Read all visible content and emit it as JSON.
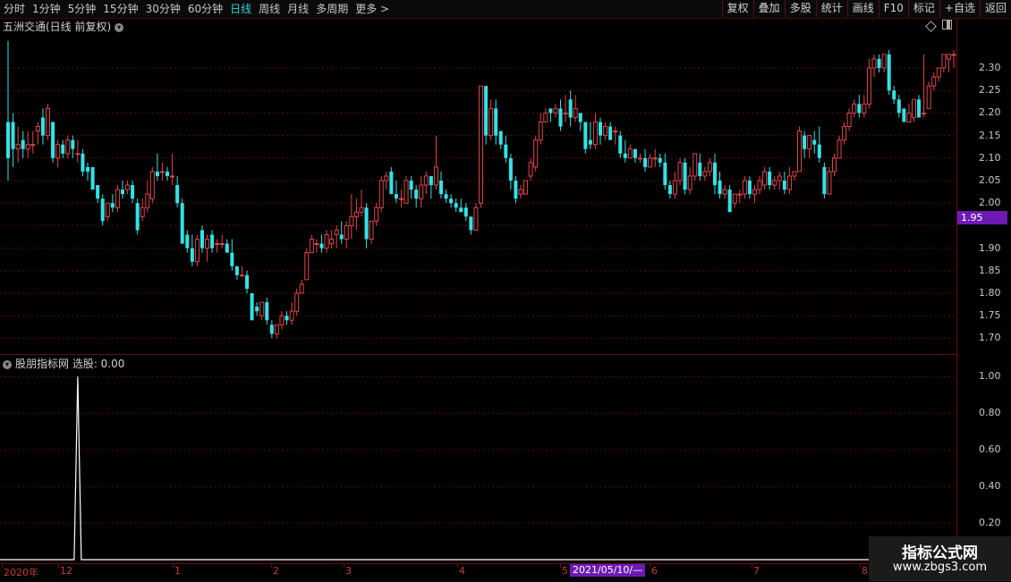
{
  "toolbar": {
    "periods": [
      "分时",
      "1分钟",
      "5分钟",
      "15分钟",
      "30分钟",
      "60分钟",
      "日线",
      "周线",
      "月线",
      "多周期",
      "更多 >"
    ],
    "active_period": "日线",
    "tools": [
      "复权",
      "叠加",
      "多股",
      "统计",
      "画线",
      "F10",
      "标记",
      "+自选",
      "返回"
    ]
  },
  "main_chart": {
    "title": "五洲交通(日线 前复权)",
    "current_price_tag": "1.95",
    "y_ticks": [
      "2.30",
      "2.25",
      "2.20",
      "2.15",
      "2.10",
      "2.05",
      "2.00",
      "1.95",
      "1.90",
      "1.85",
      "1.80",
      "1.75",
      "1.70"
    ]
  },
  "indicator": {
    "title": "股朋指标网 选股: 0.00",
    "y_ticks": [
      "1.00",
      "0.80",
      "0.60",
      "0.40",
      "0.20"
    ]
  },
  "time_axis": {
    "labels": [
      "2020年",
      "12",
      "1",
      "2",
      "3",
      "4",
      "5",
      "6",
      "7",
      "8"
    ],
    "cursor_date": "2021/05/10/—"
  },
  "watermark": {
    "title": "指标公式网",
    "url": "www.zbgs3.com"
  },
  "colors": {
    "up": "#e0464a",
    "down": "#33e2e6",
    "axis": "#6a0d0d",
    "highlight": "#6d1bb3"
  },
  "chart_data": {
    "type": "candlestick",
    "title": "五洲交通(日线 前复权)",
    "ylim": [
      1.68,
      2.35
    ],
    "current_price": 1.95,
    "candles": [
      [
        2.18,
        2.1,
        2.36,
        2.05
      ],
      [
        2.18,
        2.12,
        2.2,
        2.08
      ],
      [
        2.12,
        2.13,
        2.17,
        2.09
      ],
      [
        2.14,
        2.12,
        2.16,
        2.1
      ],
      [
        2.12,
        2.13,
        2.16,
        2.1
      ],
      [
        2.13,
        2.13,
        2.16,
        2.11
      ],
      [
        2.16,
        2.17,
        2.18,
        2.13
      ],
      [
        2.19,
        2.15,
        2.21,
        2.13
      ],
      [
        2.15,
        2.21,
        2.22,
        2.14
      ],
      [
        2.18,
        2.1,
        2.18,
        2.09
      ],
      [
        2.1,
        2.13,
        2.14,
        2.08
      ],
      [
        2.13,
        2.11,
        2.14,
        2.1
      ],
      [
        2.11,
        2.14,
        2.15,
        2.1
      ],
      [
        2.14,
        2.12,
        2.15,
        2.1
      ],
      [
        2.11,
        2.11,
        2.14,
        2.09
      ],
      [
        2.11,
        2.07,
        2.12,
        2.06
      ],
      [
        2.08,
        2.07,
        2.09,
        2.05
      ],
      [
        2.08,
        2.03,
        2.08,
        2.03
      ],
      [
        2.04,
        2.01,
        2.04,
        2.0
      ],
      [
        2.01,
        1.96,
        2.02,
        1.95
      ],
      [
        1.97,
        2.0,
        2.0,
        1.96
      ],
      [
        2.0,
        1.99,
        2.02,
        1.98
      ],
      [
        1.99,
        2.03,
        2.04,
        1.98
      ],
      [
        2.03,
        2.02,
        2.05,
        2.01
      ],
      [
        2.03,
        2.04,
        2.05,
        2.02
      ],
      [
        2.04,
        2.01,
        2.05,
        2.0
      ],
      [
        2.0,
        1.94,
        2.01,
        1.93
      ],
      [
        1.97,
        1.99,
        2.01,
        1.96
      ],
      [
        1.99,
        2.02,
        2.05,
        1.98
      ],
      [
        2.01,
        2.07,
        2.08,
        2.0
      ],
      [
        2.07,
        2.06,
        2.11,
        2.05
      ],
      [
        2.07,
        2.07,
        2.09,
        2.05
      ],
      [
        2.07,
        2.06,
        2.08,
        2.05
      ],
      [
        2.06,
        2.06,
        2.11,
        2.04
      ],
      [
        2.04,
        2.0,
        2.06,
        1.99
      ],
      [
        2.0,
        1.91,
        2.01,
        1.91
      ],
      [
        1.93,
        1.9,
        1.94,
        1.89
      ],
      [
        1.9,
        1.87,
        1.93,
        1.86
      ],
      [
        1.87,
        1.92,
        1.93,
        1.86
      ],
      [
        1.94,
        1.9,
        1.95,
        1.89
      ],
      [
        1.9,
        1.92,
        1.93,
        1.87
      ],
      [
        1.93,
        1.9,
        1.94,
        1.89
      ],
      [
        1.91,
        1.91,
        1.92,
        1.89
      ],
      [
        1.91,
        1.91,
        1.93,
        1.9
      ],
      [
        1.91,
        1.89,
        1.92,
        1.89
      ],
      [
        1.89,
        1.86,
        1.92,
        1.85
      ],
      [
        1.86,
        1.84,
        1.86,
        1.83
      ],
      [
        1.84,
        1.84,
        1.86,
        1.84
      ],
      [
        1.84,
        1.81,
        1.85,
        1.8
      ],
      [
        1.8,
        1.74,
        1.8,
        1.74
      ],
      [
        1.77,
        1.76,
        1.78,
        1.75
      ],
      [
        1.75,
        1.78,
        1.78,
        1.74
      ],
      [
        1.78,
        1.74,
        1.79,
        1.73
      ],
      [
        1.73,
        1.71,
        1.74,
        1.7
      ],
      [
        1.71,
        1.73,
        1.73,
        1.7
      ],
      [
        1.73,
        1.75,
        1.76,
        1.72
      ],
      [
        1.75,
        1.74,
        1.76,
        1.73
      ],
      [
        1.74,
        1.76,
        1.78,
        1.73
      ],
      [
        1.76,
        1.8,
        1.81,
        1.75
      ],
      [
        1.8,
        1.82,
        1.83,
        1.8
      ],
      [
        1.83,
        1.89,
        1.9,
        1.83
      ],
      [
        1.89,
        1.92,
        1.93,
        1.89
      ],
      [
        1.91,
        1.91,
        1.92,
        1.89
      ],
      [
        1.91,
        1.9,
        1.93,
        1.89
      ],
      [
        1.9,
        1.93,
        1.94,
        1.89
      ],
      [
        1.91,
        1.92,
        1.94,
        1.9
      ],
      [
        1.93,
        1.94,
        1.95,
        1.9
      ],
      [
        1.93,
        1.92,
        1.96,
        1.91
      ],
      [
        1.92,
        1.95,
        1.96,
        1.9
      ],
      [
        1.95,
        1.97,
        2.02,
        1.92
      ],
      [
        1.97,
        1.98,
        2.01,
        1.94
      ],
      [
        1.98,
        1.99,
        2.03,
        1.97
      ],
      [
        1.99,
        1.92,
        2.0,
        1.9
      ],
      [
        1.92,
        1.96,
        1.96,
        1.91
      ],
      [
        1.96,
        1.99,
        2.0,
        1.95
      ],
      [
        1.99,
        2.05,
        2.06,
        1.98
      ],
      [
        2.05,
        2.06,
        2.07,
        2.03
      ],
      [
        2.07,
        2.02,
        2.08,
        2.02
      ],
      [
        2.02,
        2.01,
        2.05,
        2.0
      ],
      [
        2.01,
        2.01,
        2.03,
        1.99
      ],
      [
        2.0,
        2.05,
        2.06,
        2.0
      ],
      [
        2.05,
        2.03,
        2.06,
        2.01
      ],
      [
        2.03,
        2.01,
        2.04,
        1.99
      ],
      [
        2.01,
        2.04,
        2.06,
        1.99
      ],
      [
        2.04,
        2.06,
        2.07,
        2.02
      ],
      [
        2.06,
        2.04,
        2.06,
        2.01
      ],
      [
        2.04,
        2.08,
        2.15,
        2.03
      ],
      [
        2.05,
        2.02,
        2.07,
        2.01
      ],
      [
        2.02,
        2.01,
        2.03,
        2.0
      ],
      [
        2.01,
        2.0,
        2.02,
        1.99
      ],
      [
        2.0,
        1.99,
        2.01,
        1.98
      ],
      [
        1.99,
        1.98,
        2.01,
        1.98
      ],
      [
        1.99,
        1.97,
        2.0,
        1.96
      ],
      [
        1.97,
        1.94,
        1.97,
        1.93
      ],
      [
        1.94,
        1.99,
        2.0,
        1.94
      ],
      [
        2.0,
        2.26,
        2.26,
        1.99
      ],
      [
        2.26,
        2.15,
        2.26,
        2.13
      ],
      [
        2.15,
        2.21,
        2.23,
        2.14
      ],
      [
        2.21,
        2.15,
        2.23,
        2.13
      ],
      [
        2.16,
        2.13,
        2.16,
        2.12
      ],
      [
        2.13,
        2.1,
        2.15,
        2.09
      ],
      [
        2.1,
        2.05,
        2.11,
        2.03
      ],
      [
        2.05,
        2.01,
        2.06,
        2.0
      ],
      [
        2.02,
        2.03,
        2.04,
        2.01
      ],
      [
        2.02,
        2.05,
        2.05,
        2.02
      ],
      [
        2.06,
        2.09,
        2.1,
        2.05
      ],
      [
        2.08,
        2.14,
        2.15,
        2.07
      ],
      [
        2.14,
        2.18,
        2.2,
        2.13
      ],
      [
        2.18,
        2.2,
        2.21,
        2.18
      ],
      [
        2.21,
        2.2,
        2.21,
        2.18
      ],
      [
        2.2,
        2.21,
        2.22,
        2.19
      ],
      [
        2.21,
        2.17,
        2.23,
        2.16
      ],
      [
        2.2,
        2.2,
        2.24,
        2.18
      ],
      [
        2.23,
        2.19,
        2.25,
        2.17
      ],
      [
        2.19,
        2.21,
        2.24,
        2.18
      ],
      [
        2.2,
        2.18,
        2.2,
        2.16
      ],
      [
        2.18,
        2.12,
        2.18,
        2.11
      ],
      [
        2.14,
        2.13,
        2.18,
        2.12
      ],
      [
        2.13,
        2.18,
        2.2,
        2.12
      ],
      [
        2.18,
        2.15,
        2.19,
        2.13
      ],
      [
        2.15,
        2.17,
        2.18,
        2.14
      ],
      [
        2.17,
        2.14,
        2.18,
        2.14
      ],
      [
        2.16,
        2.16,
        2.17,
        2.13
      ],
      [
        2.15,
        2.11,
        2.16,
        2.1
      ],
      [
        2.11,
        2.1,
        2.14,
        2.09
      ],
      [
        2.1,
        2.12,
        2.13,
        2.1
      ],
      [
        2.12,
        2.1,
        2.12,
        2.09
      ],
      [
        2.1,
        2.1,
        2.11,
        2.09
      ],
      [
        2.1,
        2.08,
        2.12,
        2.07
      ],
      [
        2.08,
        2.1,
        2.11,
        2.08
      ],
      [
        2.1,
        2.1,
        2.12,
        2.08
      ],
      [
        2.1,
        2.09,
        2.11,
        2.08
      ],
      [
        2.09,
        2.04,
        2.11,
        2.03
      ],
      [
        2.04,
        2.02,
        2.05,
        2.01
      ],
      [
        2.02,
        2.05,
        2.07,
        2.01
      ],
      [
        2.05,
        2.09,
        2.1,
        2.04
      ],
      [
        2.09,
        2.03,
        2.1,
        2.02
      ],
      [
        2.03,
        2.06,
        2.08,
        2.02
      ],
      [
        2.06,
        2.11,
        2.11,
        2.05
      ],
      [
        2.09,
        2.06,
        2.11,
        2.05
      ],
      [
        2.06,
        2.07,
        2.08,
        2.05
      ],
      [
        2.07,
        2.09,
        2.1,
        2.06
      ],
      [
        2.09,
        2.04,
        2.11,
        2.02
      ],
      [
        2.05,
        2.02,
        2.07,
        2.01
      ],
      [
        2.02,
        2.03,
        2.04,
        2.01
      ],
      [
        2.03,
        1.98,
        2.04,
        1.98
      ],
      [
        2.0,
        2.02,
        2.02,
        1.99
      ],
      [
        2.02,
        2.02,
        2.03,
        2.0
      ],
      [
        2.02,
        2.05,
        2.06,
        2.01
      ],
      [
        2.05,
        2.02,
        2.06,
        2.01
      ],
      [
        2.02,
        2.03,
        2.04,
        2.0
      ],
      [
        2.03,
        2.05,
        2.06,
        2.02
      ],
      [
        2.04,
        2.07,
        2.08,
        2.03
      ],
      [
        2.07,
        2.04,
        2.08,
        2.03
      ],
      [
        2.04,
        2.05,
        2.06,
        2.03
      ],
      [
        2.05,
        2.06,
        2.07,
        2.03
      ],
      [
        2.05,
        2.03,
        2.07,
        2.02
      ],
      [
        2.03,
        2.06,
        2.08,
        2.02
      ],
      [
        2.06,
        2.07,
        2.07,
        2.05
      ],
      [
        2.07,
        2.16,
        2.17,
        2.07
      ],
      [
        2.15,
        2.12,
        2.16,
        2.1
      ],
      [
        2.12,
        2.15,
        2.15,
        2.1
      ],
      [
        2.14,
        2.13,
        2.16,
        2.11
      ],
      [
        2.13,
        2.1,
        2.17,
        2.09
      ],
      [
        2.08,
        2.02,
        2.09,
        2.01
      ],
      [
        2.02,
        2.07,
        2.08,
        2.02
      ],
      [
        2.07,
        2.1,
        2.11,
        2.06
      ],
      [
        2.1,
        2.14,
        2.15,
        2.1
      ],
      [
        2.14,
        2.17,
        2.18,
        2.13
      ],
      [
        2.17,
        2.2,
        2.21,
        2.16
      ],
      [
        2.2,
        2.22,
        2.23,
        2.19
      ],
      [
        2.22,
        2.2,
        2.24,
        2.19
      ],
      [
        2.2,
        2.22,
        2.24,
        2.19
      ],
      [
        2.22,
        2.3,
        2.32,
        2.21
      ],
      [
        2.3,
        2.32,
        2.33,
        2.28
      ],
      [
        2.32,
        2.3,
        2.33,
        2.29
      ],
      [
        2.3,
        2.33,
        2.33,
        2.29
      ],
      [
        2.33,
        2.25,
        2.34,
        2.24
      ],
      [
        2.25,
        2.23,
        2.26,
        2.22
      ],
      [
        2.23,
        2.2,
        2.24,
        2.19
      ],
      [
        2.21,
        2.18,
        2.21,
        2.18
      ],
      [
        2.18,
        2.2,
        2.22,
        2.18
      ],
      [
        2.19,
        2.23,
        2.23,
        2.18
      ],
      [
        2.23,
        2.19,
        2.24,
        2.19
      ],
      [
        2.2,
        2.2,
        2.33,
        2.19
      ],
      [
        2.21,
        2.26,
        2.27,
        2.21
      ],
      [
        2.26,
        2.28,
        2.29,
        2.25
      ],
      [
        2.28,
        2.3,
        2.3,
        2.27
      ],
      [
        2.3,
        2.33,
        2.33,
        2.29
      ],
      [
        2.32,
        2.33,
        2.33,
        2.29
      ],
      [
        2.33,
        2.33,
        2.34,
        2.3
      ]
    ],
    "indicator": {
      "name": "选股",
      "ylim": [
        0,
        1.05
      ],
      "signal_at_candle": 14,
      "signal_value": 1.0,
      "current_value": 0.0
    }
  }
}
